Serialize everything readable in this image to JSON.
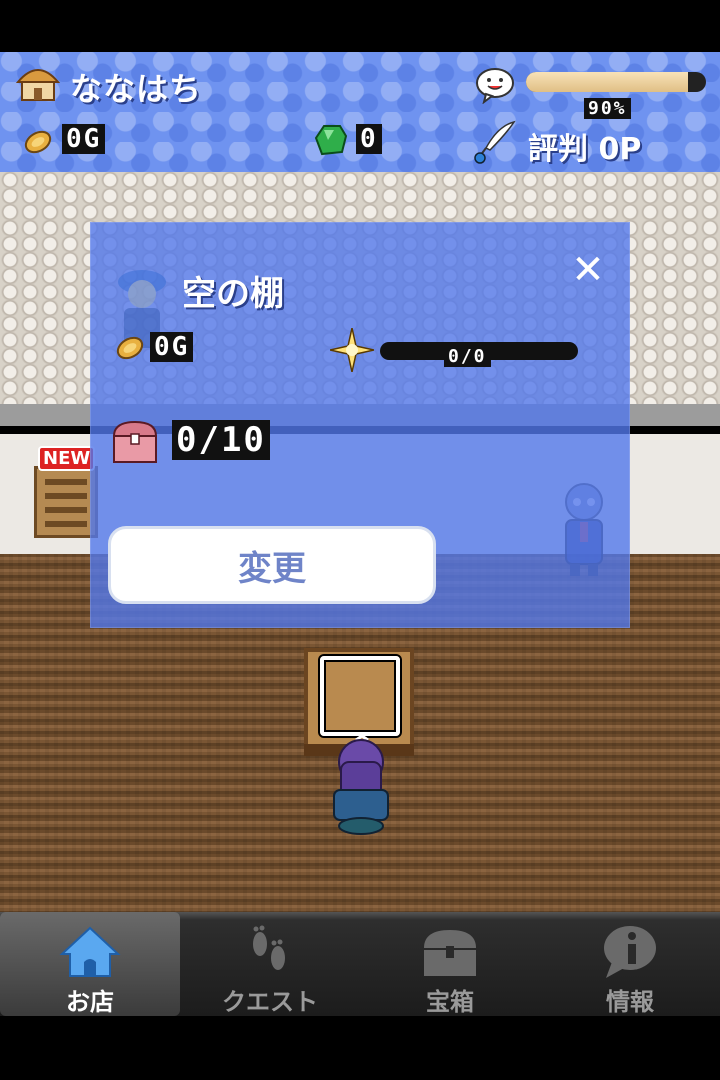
{
  "header": {
    "shop_name": "ななはち",
    "mood_percent_text": "90%",
    "mood_fraction": 0.9,
    "gold": "0G",
    "gems": "0",
    "reputation": "評判 0P"
  },
  "scene": {
    "new_badge": "NEW"
  },
  "dialog": {
    "title": "空の棚",
    "price": "0G",
    "progress_text": "0/0",
    "stock": "0/10",
    "change_button": "変更",
    "close_symbol": "✕"
  },
  "tabs": [
    {
      "label": "お店",
      "icon": "house-icon",
      "active": true
    },
    {
      "label": "クエスト",
      "icon": "footprints-icon",
      "active": false
    },
    {
      "label": "宝箱",
      "icon": "treasure-chest-icon",
      "active": false
    },
    {
      "label": "情報",
      "icon": "info-bubble-icon",
      "active": false
    }
  ],
  "colors": {
    "status_bar": "#6f93f0",
    "dialog": "#5278eb",
    "active_tab_icon": "#5aa8f0"
  }
}
